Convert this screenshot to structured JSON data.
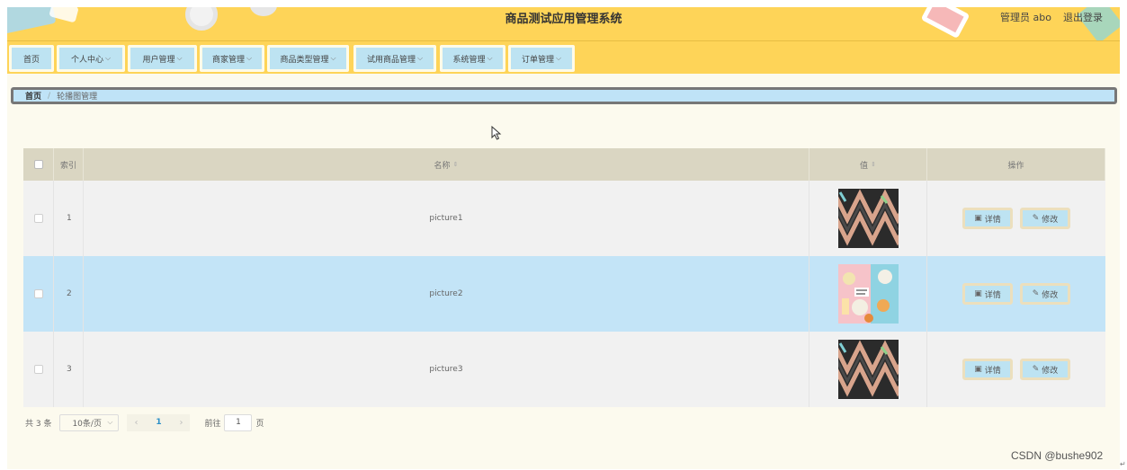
{
  "header": {
    "title": "商品测试应用管理系统",
    "user_label": "管理员 abo",
    "logout_label": "退出登录"
  },
  "nav": {
    "items": [
      {
        "label": "首页",
        "has_dropdown": false
      },
      {
        "label": "个人中心",
        "has_dropdown": true
      },
      {
        "label": "用户管理",
        "has_dropdown": true
      },
      {
        "label": "商家管理",
        "has_dropdown": true
      },
      {
        "label": "商品类型管理",
        "has_dropdown": true
      },
      {
        "label": "试用商品管理",
        "has_dropdown": true
      },
      {
        "label": "系统管理",
        "has_dropdown": true
      },
      {
        "label": "订单管理",
        "has_dropdown": true
      }
    ],
    "chevron": "⌵"
  },
  "breadcrumb": {
    "home": "首页",
    "separator": "/",
    "current": "轮播图管理"
  },
  "table": {
    "columns": {
      "index": "索引",
      "name": "名称",
      "value": "值",
      "ops": "操作"
    },
    "sort_icon": "⇕",
    "rows": [
      {
        "index": "1",
        "name": "picture1",
        "image": "dark-pattern"
      },
      {
        "index": "2",
        "name": "picture2",
        "image": "colorful-food"
      },
      {
        "index": "3",
        "name": "picture3",
        "image": "dark-pattern"
      }
    ],
    "detail_label": "详情",
    "edit_label": "修改",
    "detail_icon": "▣",
    "edit_icon": "✎"
  },
  "pagination": {
    "total": "共 3 条",
    "page_size": "10条/页",
    "prev": "‹",
    "next": "›",
    "current_page": "1",
    "goto_label": "前往",
    "goto_value": "1",
    "page_suffix": "页"
  },
  "watermark": "CSDN @bushe902",
  "corner_mark": "↵",
  "colors": {
    "header_bg": "#fed458",
    "nav_item_bg": "#bde3f2",
    "content_bg": "#fcfaee",
    "selected_row": "#c3e4f7"
  }
}
